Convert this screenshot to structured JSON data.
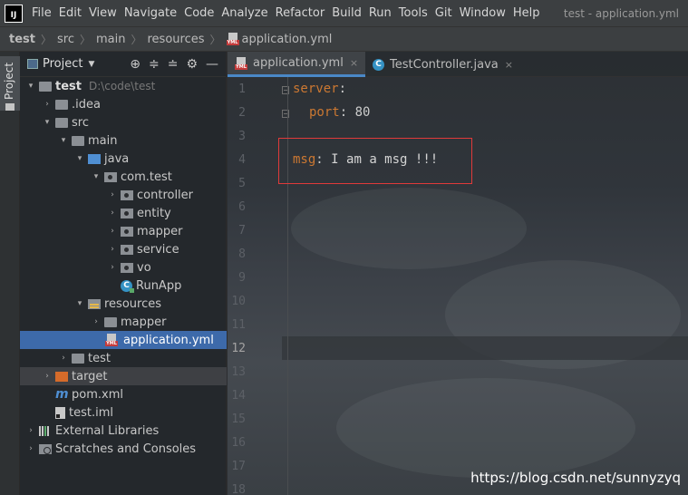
{
  "menubar": {
    "logo": "IJ",
    "items": [
      "File",
      "Edit",
      "View",
      "Navigate",
      "Code",
      "Analyze",
      "Refactor",
      "Build",
      "Run",
      "Tools",
      "Git",
      "Window",
      "Help"
    ],
    "window_title": "test - application.yml"
  },
  "breadcrumbs": [
    "test",
    "src",
    "main",
    "resources",
    "application.yml"
  ],
  "side_strip": {
    "tab_label": "Project"
  },
  "project_panel": {
    "title": "Project",
    "tree": [
      {
        "label": "test",
        "path": "D:\\code\\test",
        "icon": "module-folder-icon",
        "expanded": true
      },
      {
        "label": ".idea",
        "icon": "folder-icon",
        "expanded": false
      },
      {
        "label": "src",
        "icon": "folder-icon",
        "expanded": true
      },
      {
        "label": "main",
        "icon": "folder-icon",
        "expanded": true
      },
      {
        "label": "java",
        "icon": "source-folder-icon",
        "expanded": true
      },
      {
        "label": "com.test",
        "icon": "package-icon",
        "expanded": true
      },
      {
        "label": "controller",
        "icon": "package-icon",
        "expanded": false
      },
      {
        "label": "entity",
        "icon": "package-icon",
        "expanded": false
      },
      {
        "label": "mapper",
        "icon": "package-icon",
        "expanded": false
      },
      {
        "label": "service",
        "icon": "package-icon",
        "expanded": false
      },
      {
        "label": "vo",
        "icon": "package-icon",
        "expanded": false
      },
      {
        "label": "RunApp",
        "icon": "run-class-icon"
      },
      {
        "label": "resources",
        "icon": "resources-folder-icon",
        "expanded": true
      },
      {
        "label": "mapper",
        "icon": "folder-icon",
        "expanded": false
      },
      {
        "label": "application.yml",
        "icon": "yml-file-icon",
        "selected": true
      },
      {
        "label": "test",
        "icon": "folder-icon",
        "expanded": false
      },
      {
        "label": "target",
        "icon": "excluded-folder-icon",
        "expanded": false
      },
      {
        "label": "pom.xml",
        "icon": "maven-icon"
      },
      {
        "label": "test.iml",
        "icon": "iml-file-icon"
      },
      {
        "label": "External Libraries",
        "icon": "libraries-icon",
        "expanded": false
      },
      {
        "label": "Scratches and Consoles",
        "icon": "scratches-icon",
        "expanded": false
      }
    ]
  },
  "editor": {
    "tabs": [
      {
        "label": "application.yml",
        "close": "×",
        "active": true
      },
      {
        "label": "TestController.java",
        "close": "×",
        "active": false
      }
    ],
    "line_numbers": [
      "1",
      "2",
      "3",
      "4",
      "5",
      "6",
      "7",
      "8",
      "9",
      "10",
      "11",
      "12",
      "13",
      "14",
      "15",
      "16",
      "17",
      "18"
    ],
    "current_line": "12",
    "code": {
      "line1": {
        "key": "server",
        "punc": ":"
      },
      "line2": {
        "key": "port",
        "punc": ":",
        "value": "80"
      },
      "line4": {
        "key": "msg",
        "punc": ":",
        "value": "I am a msg !!!"
      }
    }
  },
  "watermark": "https://blog.csdn.net/sunnyzyq",
  "colors": {
    "accent": "#4a88c7",
    "selection": "#3d6aaa",
    "yaml_key": "#cc7832",
    "highlight_box": "#e03a3a"
  }
}
